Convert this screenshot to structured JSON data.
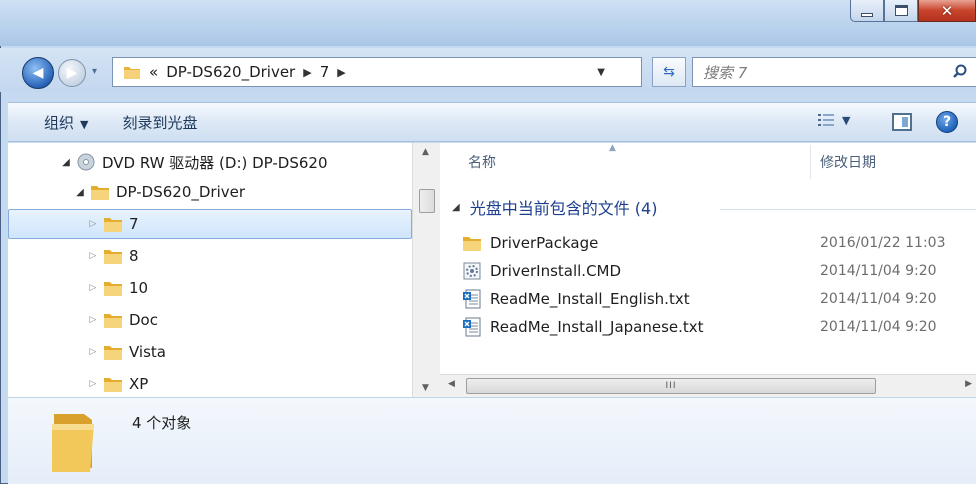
{
  "window": {
    "controls": [
      "minimize",
      "maximize",
      "close"
    ]
  },
  "navigation": {
    "breadcrumb": [
      {
        "label": "«"
      },
      {
        "label": "DP-DS620_Driver"
      },
      {
        "label": "7"
      }
    ],
    "search_placeholder": "搜索 7"
  },
  "toolbar": {
    "organize_label": "组织",
    "burn_label": "刻录到光盘"
  },
  "tree": {
    "items": [
      {
        "label": "DVD RW 驱动器 (D:) DP-DS620",
        "type": "drive",
        "expanded": true
      },
      {
        "label": "DP-DS620_Driver",
        "type": "folder",
        "expanded": true
      },
      {
        "label": "7",
        "type": "folder",
        "selected": true
      },
      {
        "label": "8",
        "type": "folder"
      },
      {
        "label": "10",
        "type": "folder"
      },
      {
        "label": "Doc",
        "type": "folder"
      },
      {
        "label": "Vista",
        "type": "folder"
      },
      {
        "label": "XP",
        "type": "folder"
      }
    ]
  },
  "content": {
    "columns": {
      "name": "名称",
      "modified": "修改日期"
    },
    "group_title": "光盘中当前包含的文件 (4)",
    "files": [
      {
        "name": "DriverPackage",
        "date": "2016/01/22 11:03",
        "icon": "folder-icon"
      },
      {
        "name": "DriverInstall.CMD",
        "date": "2014/11/04 9:20",
        "icon": "cmd-file-icon"
      },
      {
        "name": "ReadMe_Install_English.txt",
        "date": "2014/11/04 9:20",
        "icon": "text-file-icon"
      },
      {
        "name": "ReadMe_Install_Japanese.txt",
        "date": "2014/11/04 9:20",
        "icon": "text-file-icon"
      }
    ],
    "scroll_thumb_glyph": "III"
  },
  "details": {
    "status": "4 个对象"
  },
  "colors": {
    "selection_bg": "#cfe5fb",
    "group_title": "#1e3f8f",
    "folder_yellow": "#f3c85b"
  }
}
